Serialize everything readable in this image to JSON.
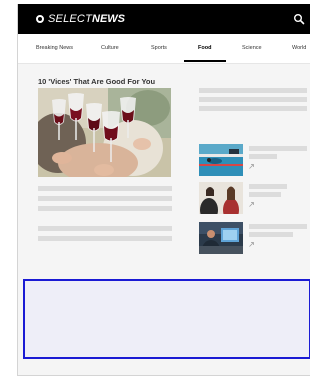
{
  "header": {
    "logo_select": "SELECT",
    "logo_news": "NEWS",
    "search_icon": "search-icon",
    "background": "#000000"
  },
  "nav": {
    "items": [
      "Breaking News",
      "Culture",
      "Sports",
      "Food",
      "Science",
      "World"
    ],
    "active": "Food"
  },
  "article": {
    "headline": "10 'Vices' That Are Good For You"
  },
  "sidebar": {
    "thumbnails": [
      "swimming-pool-photo",
      "two-people-talking-photo",
      "computer-desk-photo"
    ]
  },
  "ad_slot": {
    "border_color": "#1a1ad4",
    "fill_color": "#eeeef8"
  }
}
